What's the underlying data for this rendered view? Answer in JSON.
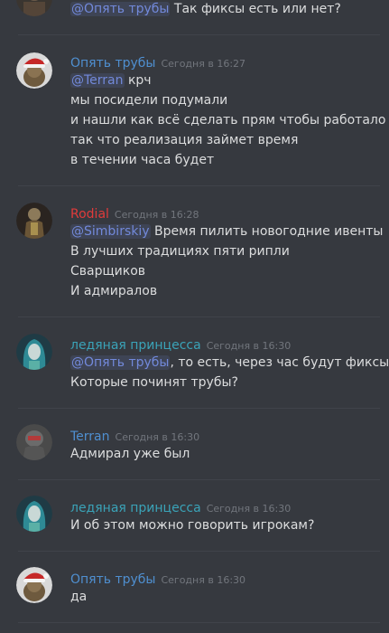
{
  "colors": {
    "background": "#36393f",
    "text": "#dcddde",
    "timestamp": "#72767d",
    "mention": "#7289da",
    "name_blue": "#4f8fd0",
    "name_red": "#e03b3b",
    "name_teal": "#3aa3b8"
  },
  "messages": [
    {
      "lines": [
        {
          "mention": "@Опять трубы",
          "text": " Так фиксы есть или нет?"
        }
      ]
    },
    {
      "author": "Опять трубы",
      "timestamp": "Сегодня в 16:27",
      "avatar_icon": "santa-hat-avatar-icon",
      "lines": [
        {
          "mention": "@Terran",
          "text": " крч"
        },
        {
          "text": "мы посидели подумали"
        },
        {
          "text": "и нашли как всё сделать прям чтобы работало"
        },
        {
          "text": "так что реализация займет время"
        },
        {
          "text": "в течении часа будет"
        }
      ]
    },
    {
      "author": "Rodial",
      "timestamp": "Сегодня в 16:28",
      "avatar_icon": "armored-figure-avatar-icon",
      "lines": [
        {
          "mention": "@Simbirskiy",
          "text": " Время пилить новогодние ивенты"
        },
        {
          "text": "В лучших традициях пяти рипли"
        },
        {
          "text": "Сварщиков"
        },
        {
          "text": "И адмиралов"
        }
      ]
    },
    {
      "author": "ледяная принцесса",
      "timestamp": "Сегодня в 16:30",
      "avatar_icon": "ice-princess-avatar-icon",
      "lines": [
        {
          "mention": "@Опять трубы",
          "text": ", то есть, через час будут фиксы?"
        },
        {
          "text": "Которые починят трубы?"
        }
      ]
    },
    {
      "author": "Terran",
      "timestamp": "Сегодня в 16:30",
      "avatar_icon": "soldier-avatar-icon",
      "lines": [
        {
          "text": "Адмирал уже был"
        }
      ]
    },
    {
      "author": "ледяная принцесса",
      "timestamp": "Сегодня в 16:30",
      "avatar_icon": "ice-princess-avatar-icon",
      "lines": [
        {
          "text": "И об этом можно говорить игрокам?"
        }
      ]
    },
    {
      "author": "Опять трубы",
      "timestamp": "Сегодня в 16:30",
      "avatar_icon": "santa-hat-avatar-icon",
      "lines": [
        {
          "text": "да"
        }
      ]
    }
  ]
}
